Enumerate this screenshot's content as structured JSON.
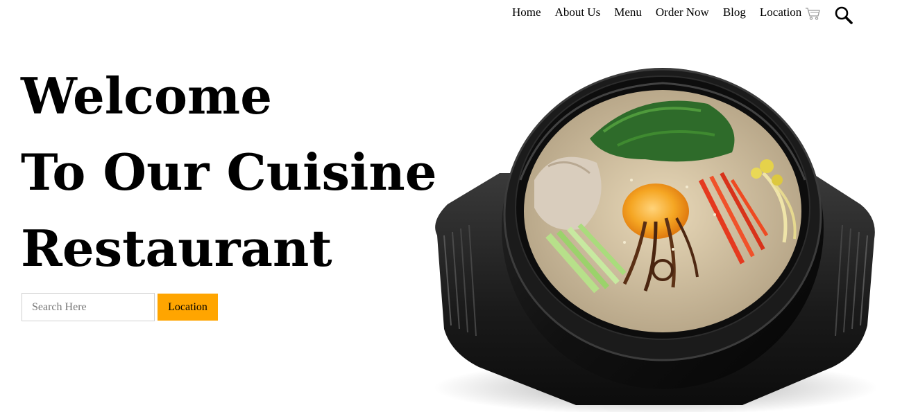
{
  "nav": {
    "items": [
      {
        "label": "Home"
      },
      {
        "label": "About Us"
      },
      {
        "label": "Menu"
      },
      {
        "label": "Order Now"
      },
      {
        "label": "Blog"
      },
      {
        "label": "Location"
      }
    ],
    "icons": [
      "cart-icon",
      "search-icon"
    ]
  },
  "hero": {
    "line1": "Welcome",
    "line2": "To Our Cuisine",
    "line3": "Restaurant"
  },
  "search": {
    "placeholder": "Search Here",
    "button_label": "Location"
  },
  "colors": {
    "accent": "#ffa500",
    "text": "#000000",
    "background": "#ffffff"
  }
}
